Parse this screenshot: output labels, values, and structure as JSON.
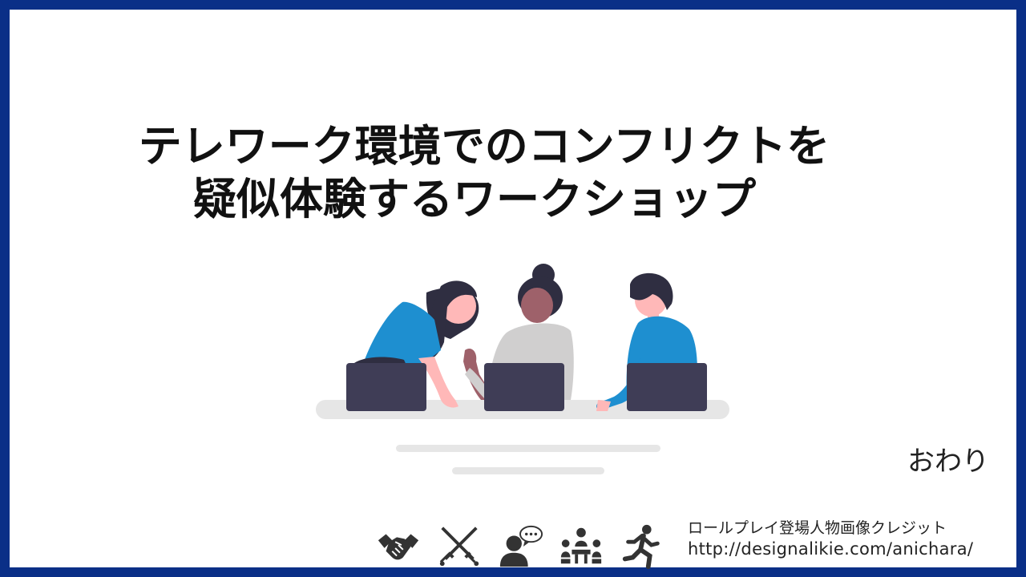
{
  "slide": {
    "title_line1": "テレワーク環境でのコンフリクトを",
    "title_line2": "疑似体験するワークショップ",
    "ending_label": "おわり",
    "border_color": "#0a2f87"
  },
  "credit": {
    "heading": "ロールプレイ登場人物画像クレジット",
    "url": "http://designalikie.com/anichara/"
  },
  "icons": [
    "handshake-icon",
    "crossed-swords-icon",
    "person-speech-icon",
    "meeting-icon",
    "running-person-icon"
  ],
  "illustration": {
    "subject": "three-people-with-laptops",
    "colors": {
      "laptop": "#3f3d56",
      "shirt_blue": "#1e8fd0",
      "hair": "#2f2e41",
      "skin": "#ffb8b8",
      "table": "#e6e6e6"
    }
  }
}
